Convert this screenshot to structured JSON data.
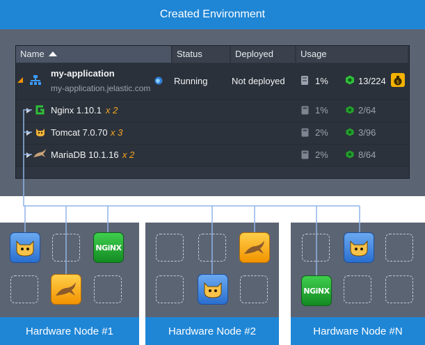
{
  "title": "Created Environment",
  "table": {
    "headers": {
      "name": "Name",
      "status": "Status",
      "deployed": "Deployed",
      "usage": "Usage"
    },
    "environment": {
      "name": "my-application",
      "domain": "my-application.jelastic.com",
      "status": "Running",
      "deployed": "Not deployed",
      "disk": "1%",
      "cloudlets": "13/224"
    },
    "nodes": [
      {
        "name": "Nginx 1.10.1",
        "count": "x 2",
        "disk": "1%",
        "cloudlets": "2/64"
      },
      {
        "name": "Tomcat 7.0.70",
        "count": "x 3",
        "disk": "2%",
        "cloudlets": "3/96"
      },
      {
        "name": "MariaDB 10.1.16",
        "count": "x 2",
        "disk": "2%",
        "cloudlets": "8/64"
      }
    ]
  },
  "hardware_nodes": [
    {
      "label": "Hardware Node #1"
    },
    {
      "label": "Hardware Node #2"
    },
    {
      "label": "Hardware Node #N"
    }
  ],
  "tiles": {
    "nginx_text": "NGiNX"
  },
  "colors": {
    "banner": "#1f86d6",
    "panel": "#5b6473",
    "table": "#2f3641",
    "accent": "#f5a623",
    "connector": "#8fb3e8"
  }
}
